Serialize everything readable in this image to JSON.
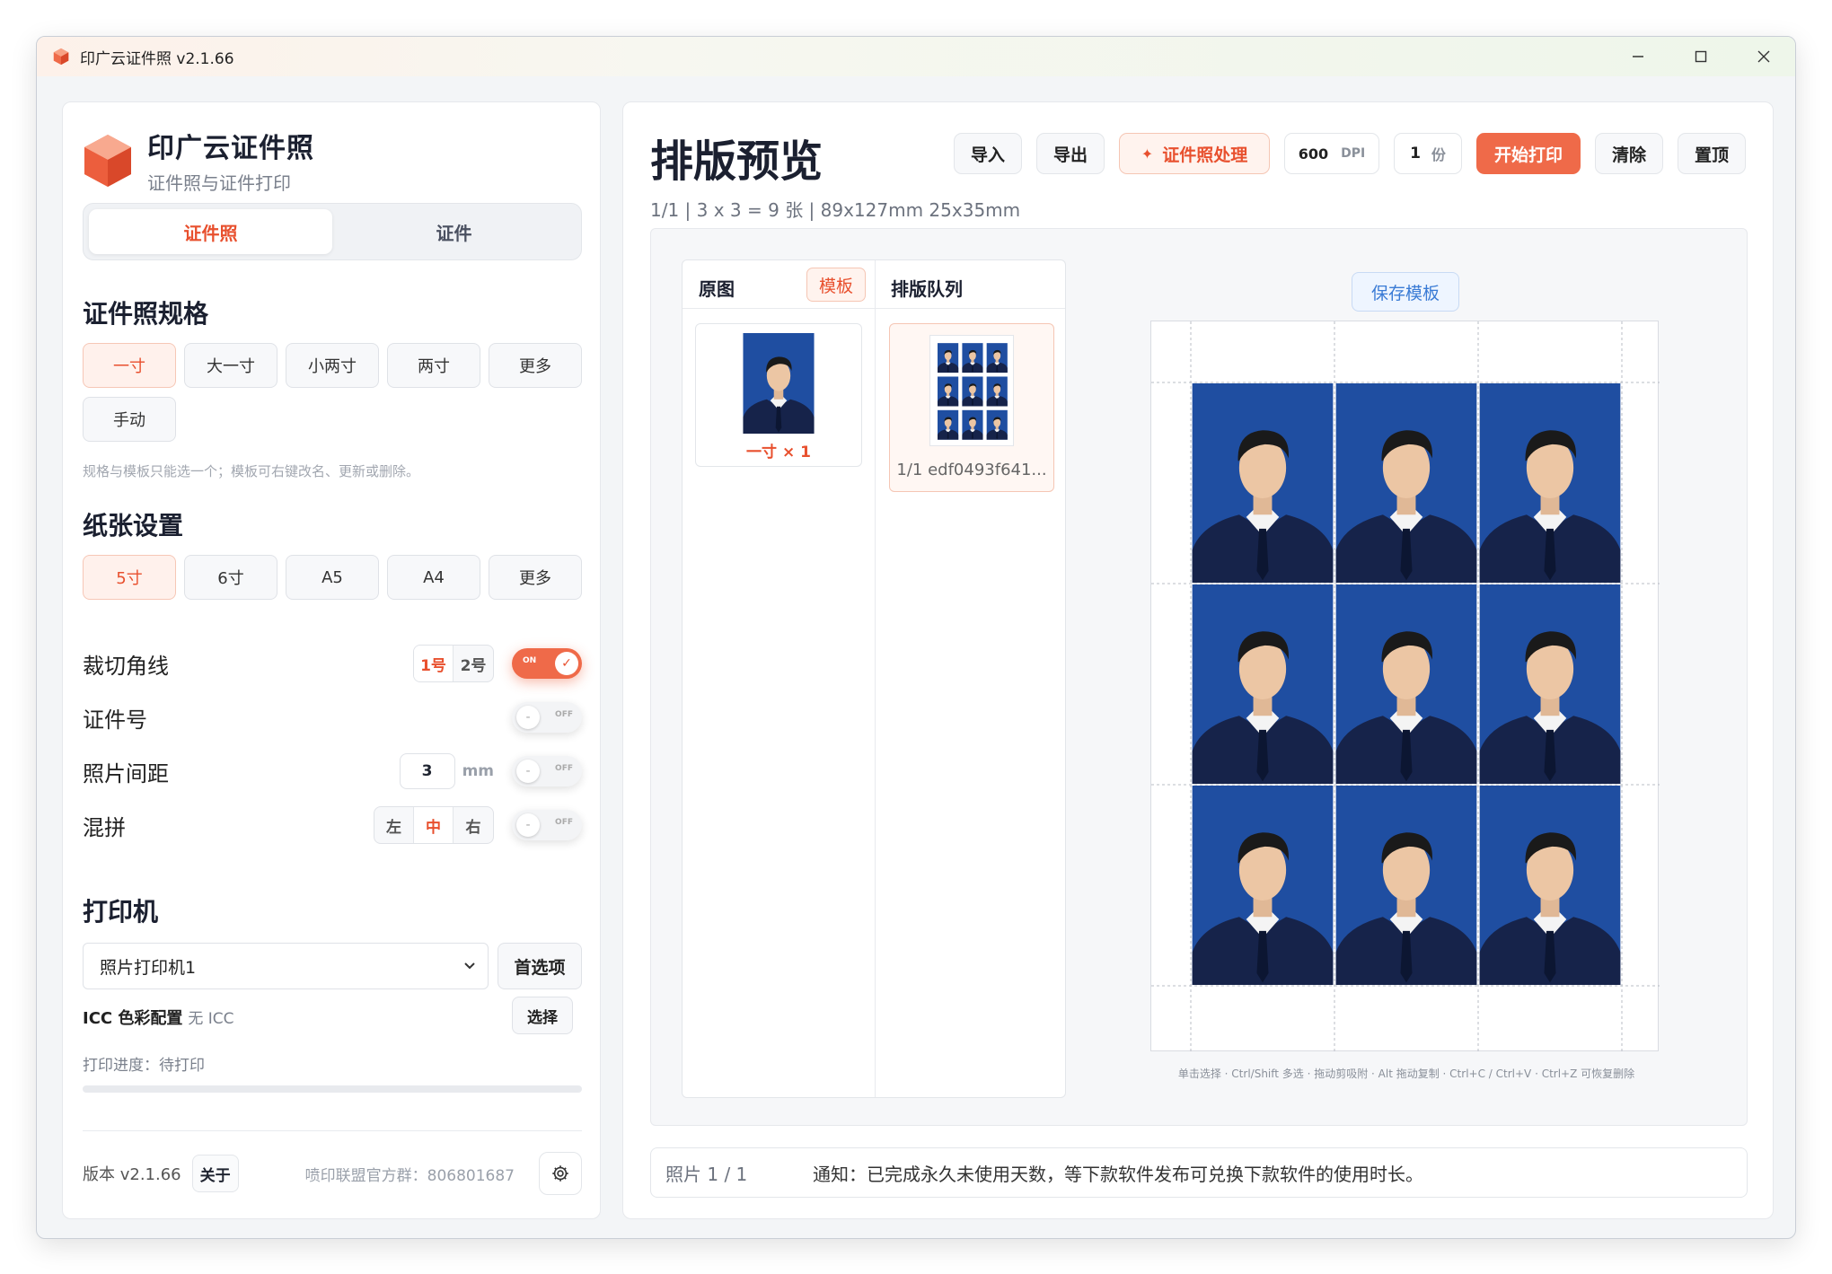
{
  "window": {
    "title": "印广云证件照 v2.1.66"
  },
  "sidebar": {
    "brand_name": "印广云证件照",
    "brand_sub": "证件照与证件打印",
    "tabs": [
      "证件照",
      "证件"
    ],
    "spec": {
      "title": "证件照规格",
      "items": [
        "一寸",
        "大一寸",
        "小两寸",
        "两寸",
        "更多",
        "手动"
      ],
      "selected": "一寸",
      "hint": "规格与模板只能选一个；模板可右键改名、更新或删除。"
    },
    "paper": {
      "title": "纸张设置",
      "items": [
        "5寸",
        "6寸",
        "A5",
        "A4",
        "更多"
      ],
      "selected": "5寸"
    },
    "options": {
      "crop_label": "裁切角线",
      "crop_choices": [
        "1号",
        "2号"
      ],
      "crop_on": true,
      "on_text": "ON",
      "off_text": "OFF",
      "id_label": "证件号",
      "id_on": false,
      "gap_label": "照片间距",
      "gap_value": "3",
      "gap_unit": "mm",
      "gap_on": false,
      "mix_label": "混拼",
      "mix_choices": [
        "左",
        "中",
        "右"
      ],
      "mix_selected": "中",
      "mix_on": false
    },
    "printer": {
      "title": "打印机",
      "selected": "照片打印机1",
      "pref_label": "首选项",
      "icc_label": "ICC 色彩配置",
      "icc_value": "无 ICC",
      "icc_btn": "选择",
      "progress_text": "打印进度：待打印",
      "progress": 0
    },
    "footer": {
      "version": "版本 v2.1.66",
      "about": "关于",
      "qq": "喷印联盟官方群：806801687"
    }
  },
  "main": {
    "title": "排版预览",
    "subtitle": "1/1 | 3 x 3 = 9 张 | 89x127mm 25x35mm",
    "toolbar": {
      "import": "导入",
      "export": "导出",
      "process": "证件照处理",
      "dpi_value": "600",
      "dpi_unit": "DPI",
      "copies_value": "1",
      "copies_unit": "份",
      "print": "开始打印",
      "clear": "清除",
      "pin": "置顶"
    },
    "source": {
      "title": "原图",
      "template_btn": "模板",
      "caption": "一寸 × 1"
    },
    "queue": {
      "title": "排版队列",
      "caption": "1/1  edf0493f641..."
    },
    "layout": {
      "rows": 3,
      "cols": 3
    },
    "save_template": "保存模板",
    "shortcuts": "单击选择 · Ctrl/Shift 多选 · 拖动剪吸附 · Alt 拖动复制 · Ctrl+C / Ctrl+V · Ctrl+Z 可恢复删除",
    "status_photo": "照片 1 / 1",
    "status_notice": "通知：已完成永久未使用天数，等下款软件发布可兑换下款软件的使用时长。"
  },
  "colors": {
    "accent": "#ef6a49",
    "photo_bg": "#1f4ea1",
    "suit": "#16234a"
  }
}
